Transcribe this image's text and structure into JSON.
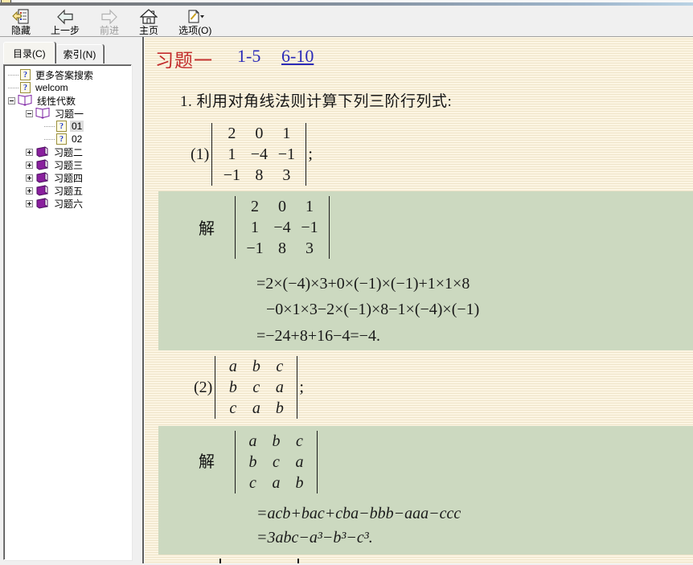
{
  "window": {
    "app_type": "html-help-viewer"
  },
  "toolbar": {
    "buttons": [
      {
        "id": "hide",
        "label": "隐藏",
        "disabled": false
      },
      {
        "id": "back",
        "label": "上一步",
        "disabled": false
      },
      {
        "id": "forward",
        "label": "前进",
        "disabled": true
      },
      {
        "id": "home",
        "label": "主页",
        "disabled": false
      },
      {
        "id": "options",
        "label": "选项(O)",
        "disabled": false,
        "has_dropdown": true
      }
    ]
  },
  "sidebar": {
    "tabs": [
      {
        "label": "目录(C)",
        "active": true
      },
      {
        "label": "索引(N)",
        "active": false
      }
    ],
    "tree": [
      {
        "label": "更多答案搜索",
        "icon": "help-page-icon",
        "depth": 0,
        "expand": "none",
        "selected": false
      },
      {
        "label": "welcom",
        "icon": "help-page-icon",
        "depth": 0,
        "expand": "none",
        "selected": false
      },
      {
        "label": "线性代数",
        "icon": "open-book-icon",
        "depth": 0,
        "expand": "minus",
        "selected": false
      },
      {
        "label": "习题一",
        "icon": "open-book-icon",
        "depth": 1,
        "expand": "minus",
        "selected": false
      },
      {
        "label": "01",
        "icon": "help-page-icon",
        "depth": 2,
        "expand": "none",
        "selected": true
      },
      {
        "label": "02",
        "icon": "help-page-icon",
        "depth": 2,
        "expand": "none",
        "selected": false
      },
      {
        "label": "习题二",
        "icon": "closed-book-icon",
        "depth": 1,
        "expand": "plus",
        "selected": false
      },
      {
        "label": "习题三",
        "icon": "closed-book-icon",
        "depth": 1,
        "expand": "plus",
        "selected": false
      },
      {
        "label": "习题四",
        "icon": "closed-book-icon",
        "depth": 1,
        "expand": "plus",
        "selected": false
      },
      {
        "label": "习题五",
        "icon": "closed-book-icon",
        "depth": 1,
        "expand": "plus",
        "selected": false
      },
      {
        "label": "习题六",
        "icon": "closed-book-icon",
        "depth": 1,
        "expand": "plus",
        "selected": false
      }
    ]
  },
  "content": {
    "header": {
      "title": "习题一",
      "links": [
        {
          "label": "1-5",
          "underlined": false
        },
        {
          "label": "6-10",
          "underlined": true
        }
      ]
    },
    "problem": "1. 利用对角线法则计算下列三阶行列式:",
    "det1": {
      "label": "(1)",
      "rows": [
        [
          "2",
          "0",
          "1"
        ],
        [
          "1",
          "−4",
          "−1"
        ],
        [
          "−1",
          "8",
          "3"
        ]
      ],
      "suffix": ";"
    },
    "sol1": {
      "label": "解",
      "rows": [
        [
          "2",
          "0",
          "1"
        ],
        [
          "1",
          "−4",
          "−1"
        ],
        [
          "−1",
          "8",
          "3"
        ]
      ],
      "lines": [
        "=2×(−4)×3+0×(−1)×(−1)+1×1×8",
        "−0×1×3−2×(−1)×8−1×(−4)×(−1)",
        "=−24+8+16−4=−4."
      ]
    },
    "det2": {
      "label": "(2)",
      "rows": [
        [
          "a",
          "b",
          "c"
        ],
        [
          "b",
          "c",
          "a"
        ],
        [
          "c",
          "a",
          "b"
        ]
      ],
      "suffix": ";"
    },
    "sol2": {
      "label": "解",
      "rows": [
        [
          "a",
          "b",
          "c"
        ],
        [
          "b",
          "c",
          "a"
        ],
        [
          "c",
          "a",
          "b"
        ]
      ],
      "lines": [
        "=acb+bac+cba−bbb−aaa−ccc",
        "=3abc−a³−b³−c³."
      ]
    }
  },
  "colors": {
    "title_red": "#c22a2a",
    "link_blue": "#2a2ab8",
    "solution_green": "#ccd9c0",
    "page_cream": "#fcf5e3",
    "chrome_gray": "#f0f0f0"
  }
}
